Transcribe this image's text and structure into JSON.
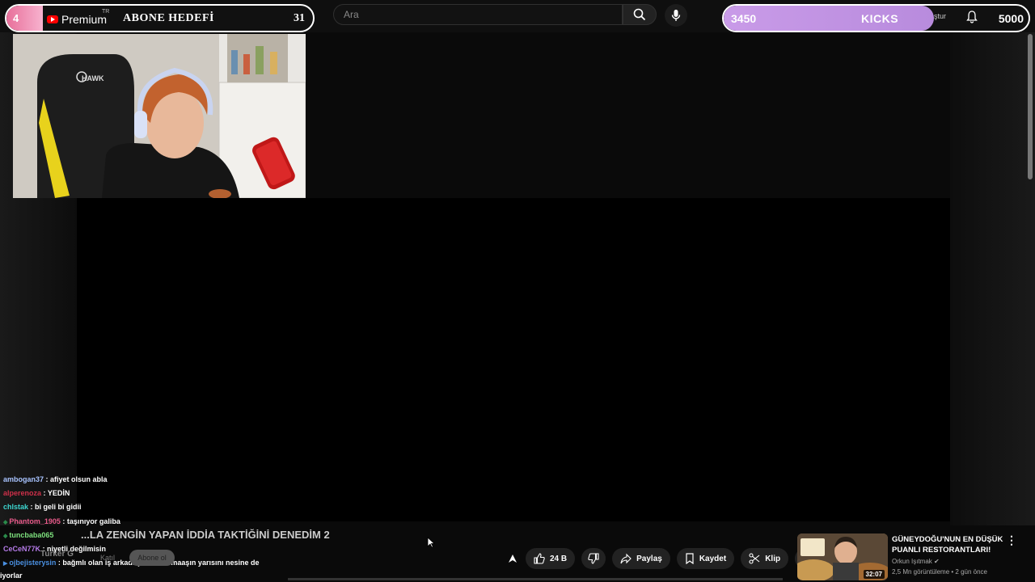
{
  "subgoal": {
    "current": "4",
    "brand": "Premium",
    "region": "TR",
    "title": "ABONE HEDEFİ",
    "target": "31",
    "fill_percent": 12
  },
  "search": {
    "placeholder": "Ara"
  },
  "kicks": {
    "current": "3450",
    "label": "KICKS",
    "partial_text": "ştur",
    "target": "5000",
    "fill_percent": 69
  },
  "chat": [
    {
      "user": "ambogan37",
      "text": " : afiyet olsun abla",
      "color": "#a9c4ff"
    },
    {
      "user": "alperenoza",
      "text": " : YEDİN",
      "color": "#d0304a"
    },
    {
      "user": "chlstak",
      "text": " : bi geli bi gidii",
      "color": "#3dd6d0"
    },
    {
      "user": "Phantom_1905",
      "text": " : taşınıyor galiba",
      "color": "#e85a8a"
    },
    {
      "user": "tuncbaba065",
      "text": "",
      "color": "#7de07d"
    },
    {
      "user": "CeCeN77K",
      "text": " : niyetli değilmisin",
      "color": "#b57be8"
    },
    {
      "user": "ojbejisterysin",
      "text": " : bağmlı olan iş arkadaşların var maaşın yarısını nesine de",
      "color": "#4a8fe0"
    },
    {
      "user": "",
      "text": "iyorlar",
      "color": "#ffffff"
    }
  ],
  "video": {
    "title": "...LA ZENGİN YAPAN İDDİA TAKTİĞİNİ DENEDİM 2",
    "channel": "Turker G",
    "join_label": "Katıl",
    "subscribe_label": "Abone ol"
  },
  "actions": {
    "likes": "24 B",
    "share": "Paylaş",
    "save": "Kaydet",
    "clip": "Klip"
  },
  "recommended": {
    "title": "GÜNEYDOĞU'NUN EN DÜŞÜK PUANLI RESTORANTLARI!",
    "channel": "Orkun Işıtmak",
    "meta": "2,5 Mn görüntüleme • 2 gün önce",
    "duration": "32:07"
  }
}
